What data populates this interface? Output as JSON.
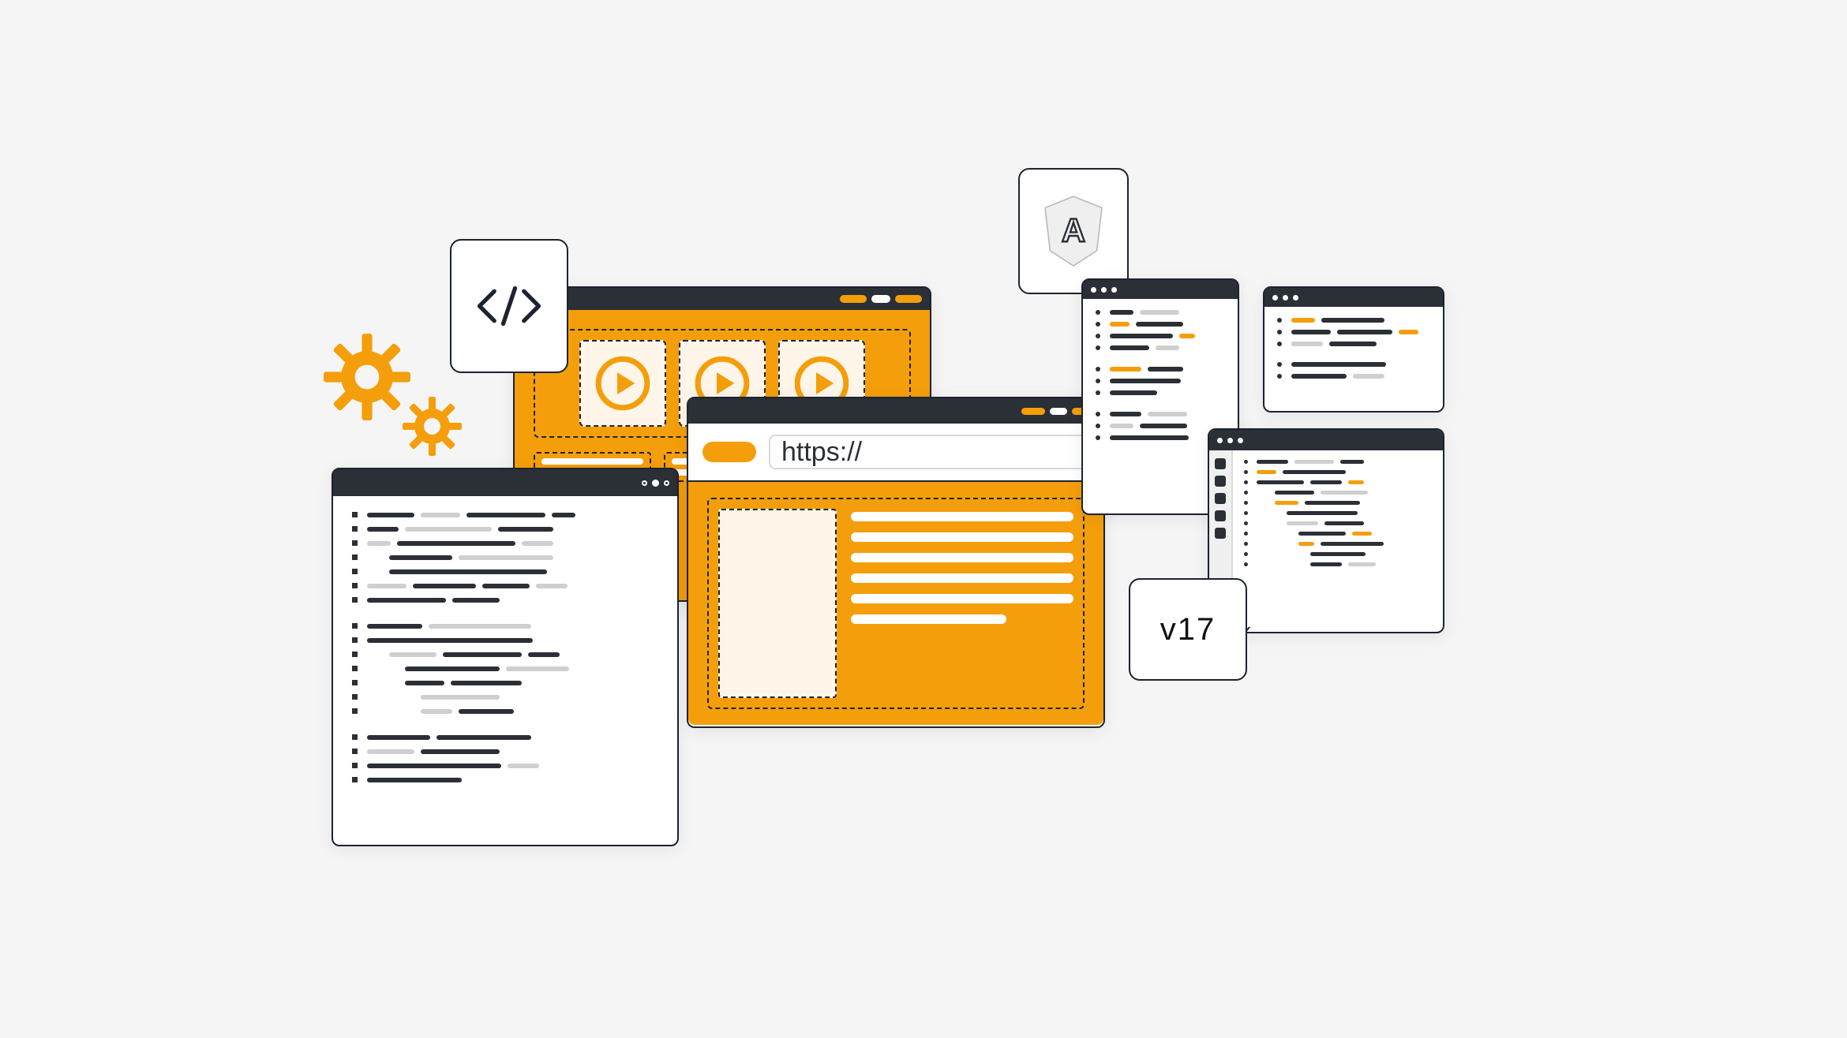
{
  "colors": {
    "accent": "#f59e0b",
    "dark": "#2b2f36",
    "light_bg": "#f5f5f5"
  },
  "code_tag": {
    "icon": "code-brackets-icon"
  },
  "angular_tag": {
    "letter": "A",
    "icon": "angular-shield-icon"
  },
  "version_tag": {
    "label": "v17"
  },
  "browser_window": {
    "url_prefix": "https://"
  },
  "gears": {
    "icon": "gear-icon",
    "color": "#f59e0b"
  },
  "media_window": {
    "play_icon": "play-circle-icon"
  }
}
